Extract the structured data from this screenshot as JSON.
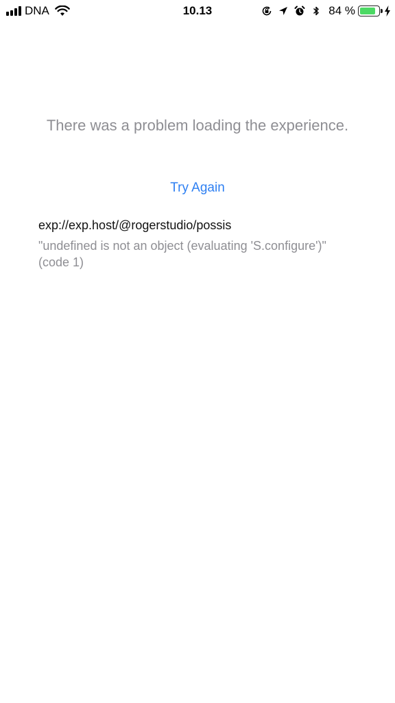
{
  "status_bar": {
    "carrier": "DNA",
    "time": "10.13",
    "battery_percent": "84 %",
    "battery_level": 0.84,
    "battery_color": "#4cd964",
    "icons": [
      "signal-icon",
      "wifi-icon",
      "orientation-lock-icon",
      "location-icon",
      "alarm-icon",
      "bluetooth-icon",
      "battery-icon",
      "charging-bolt-icon"
    ]
  },
  "error_screen": {
    "message": "There was a problem loading the experience.",
    "retry_label": "Try Again",
    "url": "exp://exp.host/@rogerstudio/possis",
    "detail": "\"undefined is not an object (evaluating 'S.configure')\" (code 1)"
  },
  "colors": {
    "link": "#2d7ff2",
    "muted_text": "#8e8e93"
  }
}
